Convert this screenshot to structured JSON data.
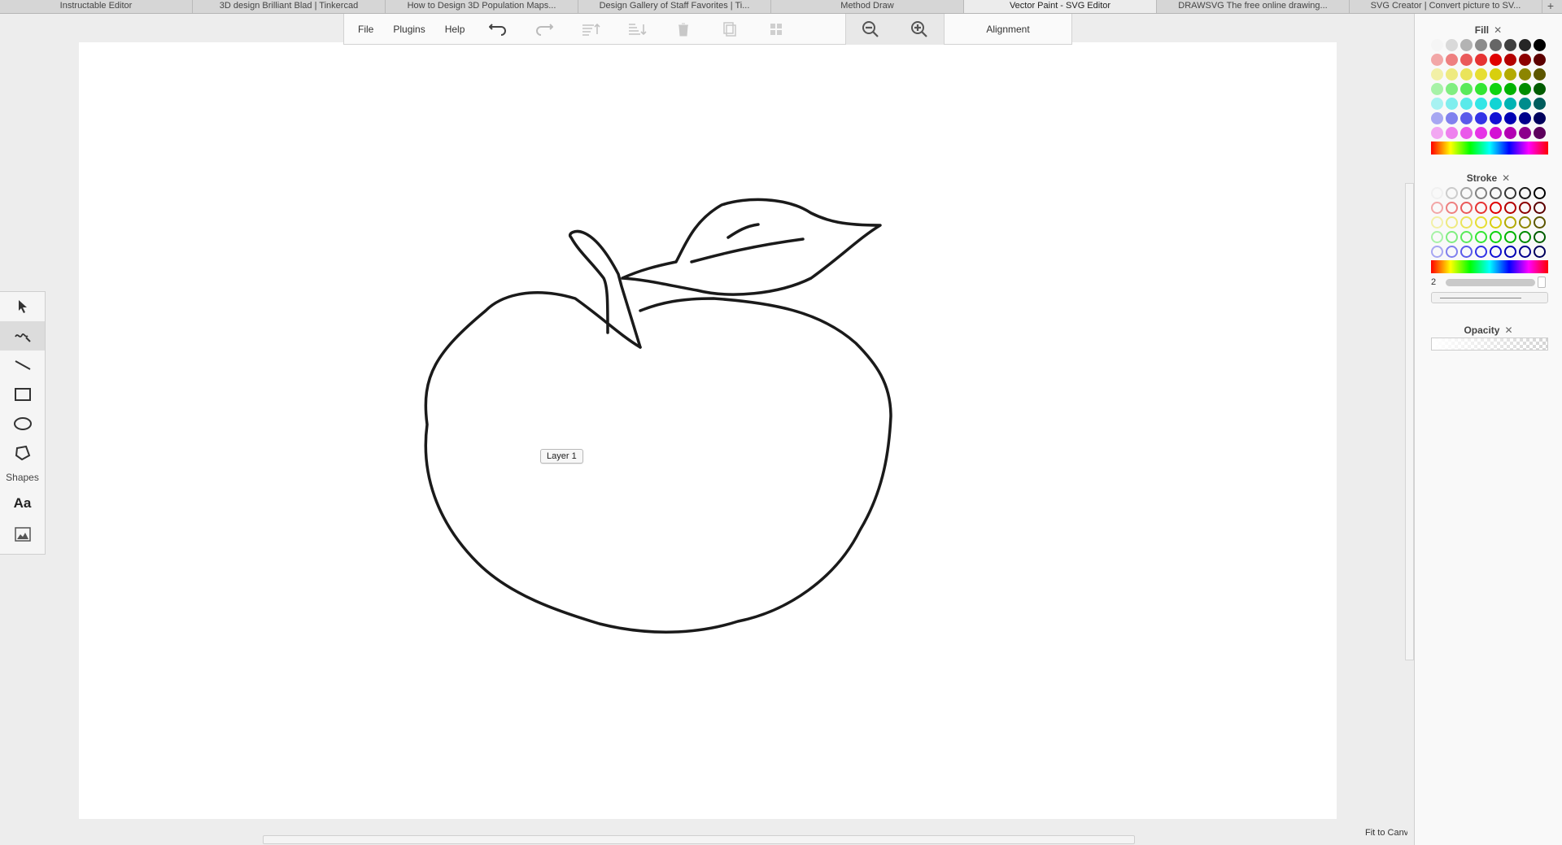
{
  "browser": {
    "tabs": [
      {
        "label": "Instructable Editor"
      },
      {
        "label": "3D design Brilliant Blad | Tinkercad"
      },
      {
        "label": "How to Design 3D Population Maps..."
      },
      {
        "label": "Design Gallery of Staff Favorites | Ti..."
      },
      {
        "label": "Method Draw"
      },
      {
        "label": "Vector Paint - SVG Editor",
        "active": true
      },
      {
        "label": "DRAWSVG The free online drawing..."
      },
      {
        "label": "SVG Creator | Convert picture to SV..."
      }
    ],
    "add_tab": "+"
  },
  "menubar": {
    "file": "File",
    "plugins": "Plugins",
    "help": "Help",
    "icons": [
      "undo-icon",
      "redo-icon",
      "bring-forward-icon",
      "send-backward-icon",
      "delete-icon",
      "clone-icon",
      "group-icon",
      "zoom-out-icon",
      "zoom-in-icon"
    ],
    "alignment": "Alignment"
  },
  "toolbox": {
    "tools": [
      "select-tool",
      "freehand-tool",
      "line-tool",
      "rectangle-tool",
      "ellipse-tool",
      "polygon-tool",
      "text-tool",
      "image-tool"
    ],
    "active_tool": "freehand-tool",
    "shapes_label": "Shapes",
    "text_tool_label": "Aa"
  },
  "canvas": {
    "layer_label": "Layer 1",
    "stroke_color": "#1a1a1a",
    "background": "#ffffff"
  },
  "panel": {
    "fill": {
      "title": "Fill",
      "close": "✕",
      "rows": [
        [
          "#f5f5f5",
          "#d9d9d9",
          "#b3b3b3",
          "#8c8c8c",
          "#666666",
          "#404040",
          "#262626",
          "#000000"
        ],
        [
          "#f2a7a7",
          "#ee8080",
          "#ea5a5a",
          "#e63333",
          "#e00000",
          "#b30000",
          "#8c0000",
          "#5c0000"
        ],
        [
          "#f2f0a7",
          "#eeea80",
          "#eae45a",
          "#e6de33",
          "#d8cf0e",
          "#b3aa00",
          "#8c8500",
          "#5c5600"
        ],
        [
          "#a7f2a7",
          "#80ee80",
          "#5aea5a",
          "#33e633",
          "#10d410",
          "#00b300",
          "#008c00",
          "#005c00"
        ],
        [
          "#a7f2f2",
          "#80eeee",
          "#5aeaea",
          "#33e6e6",
          "#10d4d4",
          "#00b3b3",
          "#008c8c",
          "#005c5c"
        ],
        [
          "#a7a7f2",
          "#8080ee",
          "#5a5aea",
          "#3333e6",
          "#1010d4",
          "#0000b3",
          "#00008c",
          "#00005c"
        ],
        [
          "#f2a7f2",
          "#ee80ee",
          "#ea5aea",
          "#e633e6",
          "#d410d4",
          "#b300b3",
          "#8c008c",
          "#5c005c"
        ]
      ]
    },
    "stroke": {
      "title": "Stroke",
      "close": "✕",
      "rows": [
        [
          "#f0f0f0",
          "#cccccc",
          "#a6a6a6",
          "#808080",
          "#595959",
          "#333333",
          "#1a1a1a",
          "#000000"
        ],
        [
          "#f2a7a7",
          "#ee8080",
          "#ea5a5a",
          "#e63333",
          "#e00000",
          "#b30000",
          "#8c0000",
          "#5c0000"
        ],
        [
          "#f2f0a7",
          "#eeea80",
          "#eae45a",
          "#e6de33",
          "#d8cf0e",
          "#b3aa00",
          "#8c8500",
          "#5c5600"
        ],
        [
          "#a7f2a7",
          "#80ee80",
          "#5aea5a",
          "#33e633",
          "#10d410",
          "#00b300",
          "#008c00",
          "#005c00"
        ],
        [
          "#a7a7f2",
          "#8080ee",
          "#5a5aea",
          "#3333e6",
          "#1010d4",
          "#0000b3",
          "#00008c",
          "#00005c"
        ]
      ],
      "width": "2"
    },
    "opacity": {
      "title": "Opacity",
      "close": "✕"
    }
  },
  "footer": {
    "fit_label": "Fit to Canvas"
  }
}
